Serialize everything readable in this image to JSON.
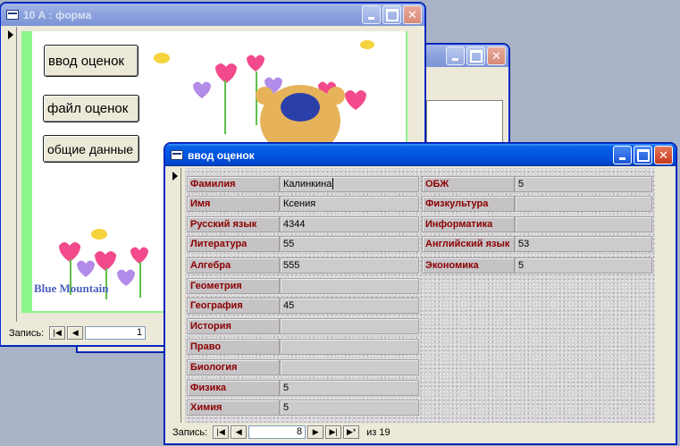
{
  "back_window": {
    "title": "10 А : форма",
    "buttons": {
      "grades_entry": "ввод оценок",
      "grades_file": "файл оценок",
      "general_data": "общие данные"
    },
    "picture_caption": "Blue Mountain",
    "nav": {
      "label": "Запись:",
      "record": "1"
    }
  },
  "front_window": {
    "title": "ввод оценок",
    "fields_left": [
      {
        "label": "Фамилия",
        "value": "Калинкина"
      },
      {
        "label": "Имя",
        "value": "Ксения"
      },
      {
        "label": "Русский язык",
        "value": "4344"
      },
      {
        "label": "Литература",
        "value": "55"
      },
      {
        "label": "Алгебра",
        "value": "555"
      },
      {
        "label": "Геометрия",
        "value": ""
      },
      {
        "label": "География",
        "value": "45"
      },
      {
        "label": "История",
        "value": ""
      },
      {
        "label": "Право",
        "value": ""
      },
      {
        "label": "Биология",
        "value": ""
      },
      {
        "label": "Физика",
        "value": "5"
      },
      {
        "label": "Химия",
        "value": "5"
      }
    ],
    "fields_right": [
      {
        "label": "ОБЖ",
        "value": "5"
      },
      {
        "label": "Физкультура",
        "value": ""
      },
      {
        "label": "Информатика",
        "value": ""
      },
      {
        "label": "Английский язык",
        "value": "53"
      },
      {
        "label": "Экономика",
        "value": "5"
      }
    ],
    "nav": {
      "label": "Запись:",
      "record": "8",
      "of_text": "из 19"
    }
  },
  "colors": {
    "titlebar": "#0054e3",
    "label_text": "#8b0000",
    "form_bg": "#8cf58c"
  }
}
